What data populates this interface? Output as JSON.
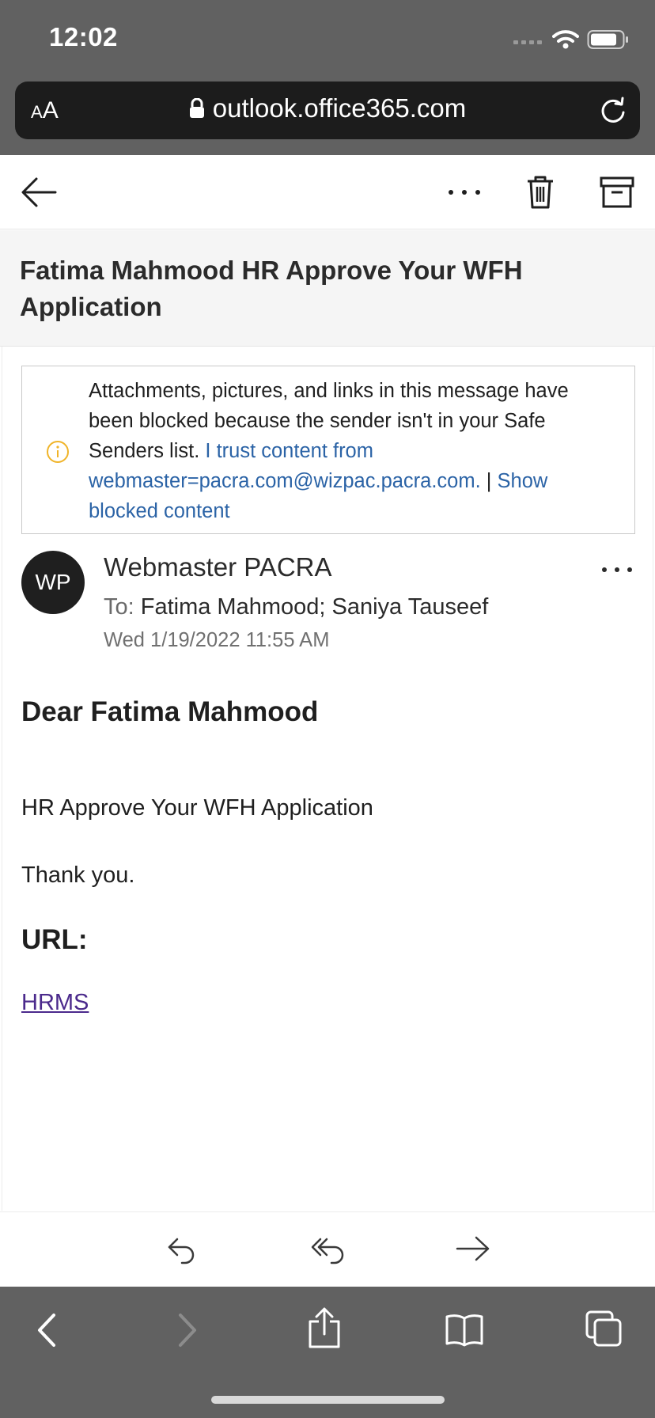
{
  "status_bar": {
    "time": "12:02"
  },
  "browser": {
    "aa_label_small": "A",
    "aa_label": "A",
    "url": "outlook.office365.com"
  },
  "toolbar": {
    "more_label": "···"
  },
  "subject": "Fatima Mahmood HR Approve Your WFH Application",
  "warning": {
    "text": "Attachments, pictures, and links in this message have been blocked because the sender isn't in your Safe Senders list.",
    "trust_link": "I trust content from webmaster=pacra.com@wizpac.pacra.com.",
    "separator": "|",
    "show_link": "Show blocked content"
  },
  "message": {
    "avatar_initials": "WP",
    "sender": "Webmaster PACRA",
    "to_label": "To:",
    "recipients": "Fatima Mahmood; Saniya Tauseef",
    "date": "Wed 1/19/2022 11:55 AM",
    "greeting": "Dear Fatima Mahmood",
    "line1": "HR Approve Your WFH Application",
    "line2": "Thank you.",
    "url_label": "URL:",
    "link_text": "HRMS"
  },
  "icons": {
    "back": "arrow-left-icon",
    "more": "more-horizontal-icon",
    "delete": "trash-icon",
    "archive": "archive-icon",
    "info": "info-icon",
    "reply": "reply-icon",
    "reply_all": "reply-all-icon",
    "forward": "forward-icon"
  },
  "colors": {
    "link": "#2b63a6",
    "visited_link": "#4b2a8c",
    "info_icon": "#f0b429",
    "chrome": "#616161"
  }
}
